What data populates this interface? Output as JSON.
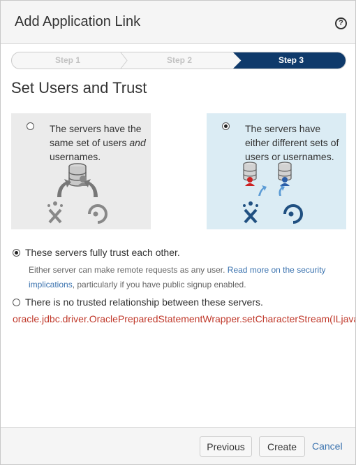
{
  "dialog": {
    "title": "Add Application Link",
    "help_icon": "help-icon",
    "help_glyph": "?"
  },
  "steps": [
    {
      "label": "Step 1",
      "state": "inactive"
    },
    {
      "label": "Step 2",
      "state": "inactive"
    },
    {
      "label": "Step 3",
      "state": "active"
    }
  ],
  "page_title": "Set Users and Trust",
  "user_options": [
    {
      "text_before": "The servers have the same set of users ",
      "text_italic": "and",
      "text_after": " usernames.",
      "selected": false,
      "icons": [
        "server-icon",
        "sync-arrows-icon",
        "jira-logo-icon",
        "fisheye-logo-icon"
      ]
    },
    {
      "text": "The servers have either different sets of users or usernames.",
      "selected": true,
      "icons": [
        "server-icon",
        "user-icon",
        "jira-logo-icon",
        "fisheye-logo-icon"
      ]
    }
  ],
  "trust": {
    "trusted_label": "These servers fully trust each other.",
    "trusted_selected": true,
    "desc_before": "Either server can make remote requests as any user. ",
    "desc_link": "Read more on the security implications",
    "desc_after": ", particularly if you have public signup enabled.",
    "untrusted_label": "There is no trusted relationship between these servers.",
    "untrusted_selected": false
  },
  "error_text": "oracle.jdbc.driver.OraclePreparedStatementWrapper.setCharacterStream(ILjava/io/Reader;J)V",
  "footer": {
    "previous_label": "Previous",
    "create_label": "Create",
    "cancel_label": "Cancel"
  },
  "colors": {
    "active_step": "#0f3a6b",
    "link": "#3b73af",
    "error": "#c0392b",
    "card_selected_bg": "#dbecf4",
    "card_unselected_bg": "#ebebeb",
    "user_red": "#cc2222",
    "user_blue": "#2a5ea8",
    "jira_blue": "#205081"
  }
}
